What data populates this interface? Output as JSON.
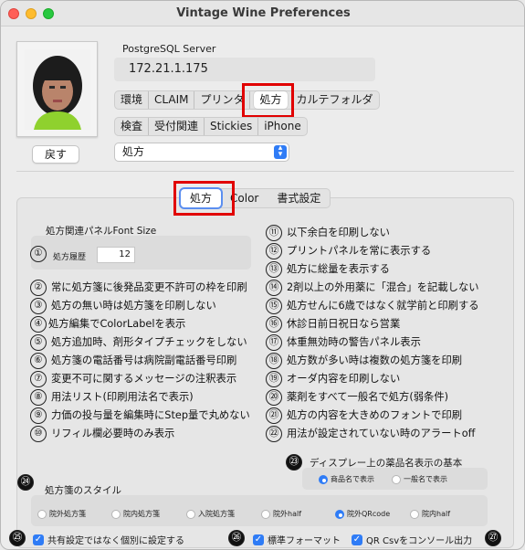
{
  "window": {
    "title": "Vintage Wine Preferences"
  },
  "profile": {
    "back_label": "戻す"
  },
  "server": {
    "label": "PostgreSQL Server",
    "address": "172.21.1.175"
  },
  "segments_row1": [
    "環境",
    "CLAIM",
    "プリンタ",
    "処方",
    "カルテフォルダ"
  ],
  "segments_row2": [
    "検査",
    "受付関連",
    "Stickies",
    "iPhone"
  ],
  "selected_segment": "処方",
  "popup": {
    "value": "処方"
  },
  "tabs": [
    "処方",
    "Color",
    "書式設定"
  ],
  "selected_tab": "処方",
  "font_panel": {
    "title": "処方関連パネルFont Size",
    "history_label": "処方履歴",
    "history_value": "12"
  },
  "left_options": [
    {
      "num": "①",
      "text": ""
    },
    {
      "num": "②",
      "text": "常に処方箋に後発品変更不許可の枠を印刷"
    },
    {
      "num": "③",
      "text": "処方の無い時は処方箋を印刷しない"
    },
    {
      "num": "④",
      "text": "処方編集でColorLabelを表示"
    },
    {
      "num": "⑤",
      "text": "処方追加時、剤形タイプチェックをしない"
    },
    {
      "num": "⑥",
      "text": "処方箋の電話番号は病院副電話番号印刷"
    },
    {
      "num": "⑦",
      "text": "変更不可に関するメッセージの注釈表示"
    },
    {
      "num": "⑧",
      "text": "用法リスト(印刷用法名で表示)"
    },
    {
      "num": "⑨",
      "text": "力価の投与量を編集時にStep量で丸めない"
    },
    {
      "num": "⑩",
      "text": "リフィル欄必要時のみ表示"
    }
  ],
  "right_options": [
    {
      "num": "⑪",
      "text": "以下余白を印刷しない"
    },
    {
      "num": "⑫",
      "text": "プリントパネルを常に表示する"
    },
    {
      "num": "⑬",
      "text": "処方に総量を表示する"
    },
    {
      "num": "⑭",
      "text": "2剤以上の外用薬に「混合」を記載しない"
    },
    {
      "num": "⑮",
      "text": "処方せんに6歳ではなく就学前と印刷する"
    },
    {
      "num": "⑯",
      "text": "休診日前日祝日なら営業"
    },
    {
      "num": "⑰",
      "text": "体重無効時の警告パネル表示"
    },
    {
      "num": "⑱",
      "text": "処方数が多い時は複数の処方箋を印刷"
    },
    {
      "num": "⑲",
      "text": "オーダ内容を印刷しない"
    },
    {
      "num": "⑳",
      "text": "薬剤をすべて一般名で処方(弱条件)"
    },
    {
      "num": "㉑",
      "text": "処方の内容を大きめのフォントで印刷"
    },
    {
      "num": "㉒",
      "text": "用法が設定されていない時のアラートoff"
    }
  ],
  "drug_name_display": {
    "num": "㉓",
    "title": "ディスプレー上の薬品名表示の基本",
    "options": [
      "商品名で表示",
      "一般名で表示"
    ],
    "selected": "商品名で表示"
  },
  "prescription_style": {
    "num": "㉔",
    "title": "処方箋のスタイル",
    "options": [
      "院外処方箋",
      "院内処方箋",
      "入院処方箋",
      "院外half",
      "院外QRcode",
      "院内half"
    ],
    "selected": "院外QRcode"
  },
  "bottom_checks": [
    {
      "num": "㉕",
      "label": "共有設定ではなく個別に設定する",
      "checked": true
    },
    {
      "num": "㉖",
      "label": "標準フォーマット",
      "checked": true
    },
    {
      "num": "",
      "label": "QR Csvをコンソール出力",
      "checked": true
    }
  ],
  "last_num": "㉗",
  "colors": {
    "accent": "#2f7cf6",
    "highlight": "#e10000"
  }
}
